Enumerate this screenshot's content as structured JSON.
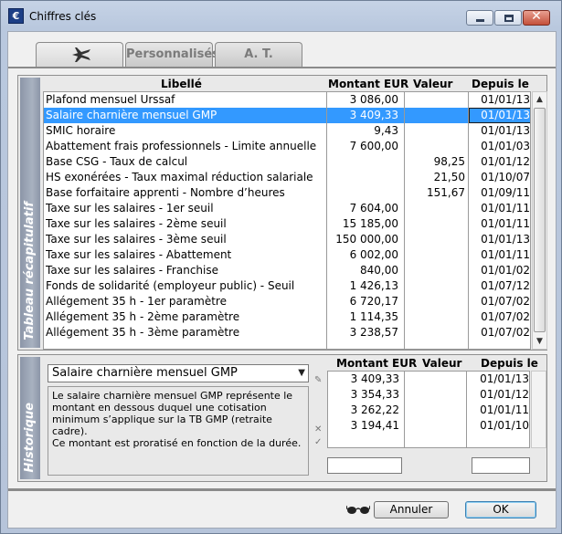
{
  "window": {
    "title": "Chiffres clés",
    "icon_glyph": "€",
    "close_glyph": "✕"
  },
  "tabs": [
    {
      "label": "",
      "icon": "airplane-icon",
      "selected": true
    },
    {
      "label": "Personnalisés",
      "selected": false
    },
    {
      "label": "A. T.",
      "selected": false
    }
  ],
  "summary": {
    "side_label": "Tableau récapitulatif",
    "headers": {
      "libelle": "Libellé",
      "montant": "Montant EUR",
      "valeur": "Valeur",
      "depuis": "Depuis le"
    },
    "rows": [
      {
        "libelle": "Plafond mensuel Urssaf",
        "montant": "3 086,00",
        "valeur": "",
        "depuis": "01/01/13"
      },
      {
        "libelle": "Salaire charnière mensuel GMP",
        "montant": "3 409,33",
        "valeur": "",
        "depuis": "01/01/13",
        "selected": true
      },
      {
        "libelle": "SMIC horaire",
        "montant": "9,43",
        "valeur": "",
        "depuis": "01/01/13"
      },
      {
        "libelle": "Abattement frais professionnels - Limite annuelle",
        "montant": "7 600,00",
        "valeur": "",
        "depuis": "01/01/03"
      },
      {
        "libelle": "Base CSG - Taux de calcul",
        "montant": "",
        "valeur": "98,25",
        "depuis": "01/01/12"
      },
      {
        "libelle": "HS exonérées - Taux maximal réduction salariale",
        "montant": "",
        "valeur": "21,50",
        "depuis": "01/10/07"
      },
      {
        "libelle": "Base forfaitaire apprenti - Nombre d’heures",
        "montant": "",
        "valeur": "151,67",
        "depuis": "01/09/11"
      },
      {
        "libelle": "Taxe sur les salaires - 1er seuil",
        "montant": "7 604,00",
        "valeur": "",
        "depuis": "01/01/11"
      },
      {
        "libelle": "Taxe sur les salaires - 2ème seuil",
        "montant": "15 185,00",
        "valeur": "",
        "depuis": "01/01/11"
      },
      {
        "libelle": "Taxe sur les salaires - 3ème seuil",
        "montant": "150 000,00",
        "valeur": "",
        "depuis": "01/01/13"
      },
      {
        "libelle": "Taxe sur les salaires - Abattement",
        "montant": "6 002,00",
        "valeur": "",
        "depuis": "01/01/11"
      },
      {
        "libelle": "Taxe sur les salaires - Franchise",
        "montant": "840,00",
        "valeur": "",
        "depuis": "01/01/02"
      },
      {
        "libelle": "Fonds de solidarité (employeur public) - Seuil",
        "montant": "1 426,13",
        "valeur": "",
        "depuis": "01/07/12"
      },
      {
        "libelle": "Allégement 35 h - 1er paramètre",
        "montant": "6 720,17",
        "valeur": "",
        "depuis": "01/07/02"
      },
      {
        "libelle": "Allégement 35 h - 2ème paramètre",
        "montant": "1 114,35",
        "valeur": "",
        "depuis": "01/07/02"
      },
      {
        "libelle": "Allégement 35 h - 3ème paramètre",
        "montant": "3 238,57",
        "valeur": "",
        "depuis": "01/07/02"
      }
    ]
  },
  "history": {
    "side_label": "Historique",
    "selected_item": "Salaire charnière mensuel GMP",
    "description": [
      "Le salaire charnière mensuel GMP représente le montant en dessous duquel une cotisation minimum s’applique sur la TB GMP (retraite cadre).",
      "Ce montant est proratisé en fonction de la durée."
    ],
    "headers": {
      "montant": "Montant EUR",
      "valeur": "Valeur",
      "depuis": "Depuis le"
    },
    "rows": [
      {
        "montant": "3 409,33",
        "valeur": "",
        "depuis": "01/01/13"
      },
      {
        "montant": "3 354,33",
        "valeur": "",
        "depuis": "01/01/12"
      },
      {
        "montant": "3 262,22",
        "valeur": "",
        "depuis": "01/01/11"
      },
      {
        "montant": "3 194,41",
        "valeur": "",
        "depuis": "01/01/10"
      }
    ]
  },
  "footer": {
    "cancel_label": "Annuler",
    "ok_label": "OK"
  }
}
